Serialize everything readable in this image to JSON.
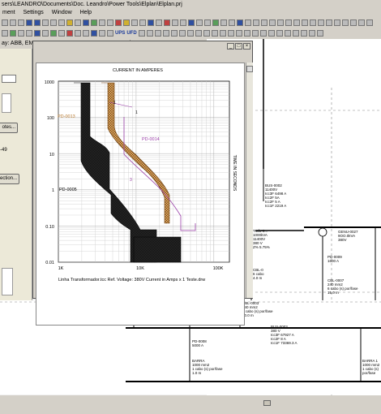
{
  "window": {
    "title": "sers\\LEANDRO\\Documents\\Doc. Leandro\\Power Tools\\Elplan\\Elplan.prj"
  },
  "menu": {
    "items": [
      "ment",
      "Settings",
      "Window",
      "Help"
    ]
  },
  "toolbar": {
    "ups_label": "UPS",
    "ufd_label": "UFD"
  },
  "infobar": {
    "text": "ay:   ABB, EMAX, PR112, LSI, 800-5000AF, UL, pagina 48-49"
  },
  "left_panel": {
    "notes_button": "otes...",
    "label_49": "-49",
    "selection_button": "ection..."
  },
  "chart": {
    "title": "CURRENT IN AMPERES",
    "ylabel": "TIME IN SECONDS",
    "y_ticks": [
      "1000",
      "100",
      "10",
      "1",
      "0.10",
      "0.01"
    ],
    "x_ticks": [
      "1K",
      "10K",
      "100K"
    ],
    "footer": "Linha Transformador.tcc   Ref. Voltage: 380V   Current in Amps x 1   Teste.drw",
    "labels": {
      "pd0013": "PD-0013",
      "pd0014": "PD-0014",
      "pd0005": "PD-0005",
      "curve_1a": "1",
      "curve_1b": "1",
      "curve_3": "3"
    }
  },
  "schematic": {
    "bus0002": [
      "BUS-0002",
      "11400V",
      "Icc3F 6498 A",
      "Icc2F 5A",
      "Icc2F 5 A",
      "Icc1F 2219 A"
    ],
    "trafo": [
      "Trafo-0...",
      "1000kVA",
      "11400V",
      "380 V",
      "Z% 5.75%"
    ],
    "genu": [
      "GENU-0027",
      "9OO.0kVA",
      "380V"
    ],
    "pd0009": [
      "PD-0009",
      "1600 A"
    ],
    "cbl0007": [
      "CBL-0007",
      "240 mm2",
      "6 cabo (s) por/fase",
      "15.0 m"
    ],
    "pd0010": [
      "PD-0010",
      "1600 A"
    ],
    "cbl0001": [
      "CBL-0001",
      "240 mm2",
      "6 cabo (s) por/fase",
      "18.0 m"
    ],
    "cbl0002": [
      "CBL-0002",
      "240 mm2",
      "6 cabo (s) por/fase",
      "10.0 m"
    ],
    "cbl0003": [
      "CBL-0003",
      "240 mm2",
      "6 cabo (s) por/fase",
      "20.0 m"
    ],
    "bus0003": [
      "BUS-0003",
      "380 V",
      "Icc3F 67927 A",
      "Icc2F 8 A",
      "Icc1F 73369.3 A"
    ],
    "pd0003": [
      "PD-0003",
      "3200 A"
    ],
    "pd0008": [
      "PD-0008",
      "5000 A"
    ],
    "barra1": [
      "BARRA",
      "1000 mm2",
      "1 cabo (s) por/fase",
      "1.0 m"
    ],
    "barra2": [
      "BARRA",
      "1000 mm2",
      "1 cabo (s) por/fase",
      "1.0 m"
    ],
    "barra3": [
      "BARRA 1",
      "1000 mm2",
      "1 cabo (s) por/fase"
    ],
    "pd0013_label": "PD-0013",
    "pd0014_label": "PD-0014",
    "cbl_small": [
      "CBL-0",
      "6 cabo",
      "4.0 m"
    ],
    "cbl_right": [
      "CBL-0",
      "6 cabo",
      "4.0 m"
    ]
  }
}
